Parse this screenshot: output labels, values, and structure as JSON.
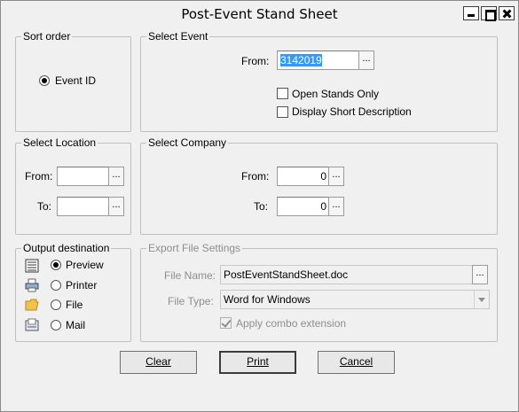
{
  "window": {
    "title": "Post-Event Stand Sheet"
  },
  "sort_order": {
    "legend": "Sort order",
    "option_label": "Event ID",
    "selected": true
  },
  "select_event": {
    "legend": "Select Event",
    "from_label": "From:",
    "from_value": "3142019",
    "open_stands_label": "Open Stands Only",
    "open_stands_checked": false,
    "short_desc_label": "Display Short Description",
    "short_desc_checked": false
  },
  "select_location": {
    "legend": "Select Location",
    "from_label": "From:",
    "from_value": "",
    "to_label": "To:",
    "to_value": ""
  },
  "select_company": {
    "legend": "Select Company",
    "from_label": "From:",
    "from_value": "0",
    "to_label": "To:",
    "to_value": "0"
  },
  "output_destination": {
    "legend": "Output destination",
    "options": [
      {
        "label": "Preview",
        "icon": "preview-icon",
        "selected": true
      },
      {
        "label": "Printer",
        "icon": "printer-icon",
        "selected": false
      },
      {
        "label": "File",
        "icon": "folder-icon",
        "selected": false
      },
      {
        "label": "Mail",
        "icon": "mail-icon",
        "selected": false
      }
    ]
  },
  "export_settings": {
    "legend": "Export  File Settings",
    "file_name_label": "File Name:",
    "file_name_value": "PostEventStandSheet.doc",
    "file_type_label": "File Type:",
    "file_type_value": "Word for Windows",
    "apply_combo_label": "Apply combo extension",
    "apply_combo_checked": true
  },
  "buttons": {
    "clear": "Clear",
    "print": "Print",
    "cancel": "Cancel"
  },
  "browse_label": "...",
  "colors": {
    "selection": "#3399ff",
    "disabled_text": "#8e8e8e",
    "dialog_bg": "#f0f0f0"
  }
}
